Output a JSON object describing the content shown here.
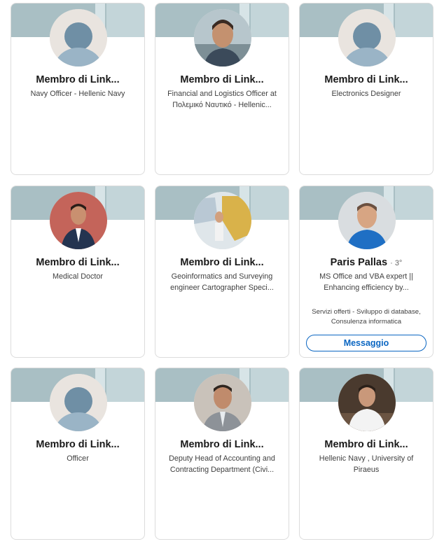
{
  "cards": [
    {
      "name": "Membro di Link...",
      "headline": "Navy Officer - Hellenic Navy",
      "avatar": "default-avatar"
    },
    {
      "name": "Membro di Link...",
      "headline": "Financial and Logistics Officer at Πολεμικό Ναυτικό - Hellenic...",
      "avatar": "profile-photo"
    },
    {
      "name": "Membro di Link...",
      "headline": "Electronics Designer",
      "avatar": "default-avatar"
    },
    {
      "name": "Membro di Link...",
      "headline": "Medical Doctor",
      "avatar": "profile-photo"
    },
    {
      "name": "Membro di Link...",
      "headline": "Geoinformatics and Surveying engineer Cartographer Speci...",
      "avatar": "profile-photo"
    },
    {
      "name": "Paris Pallas",
      "degree": "· 3°",
      "headline": "MS Office and VBA expert || Enhancing efficiency by...",
      "services": "Servizi offerti - Sviluppo di database, Consulenza informatica",
      "button": "Messaggio",
      "avatar": "profile-photo"
    },
    {
      "name": "Membro di Link...",
      "headline": "Officer",
      "avatar": "default-avatar"
    },
    {
      "name": "Membro di Link...",
      "headline": "Deputy Head of Accounting and Contracting Department (Civi...",
      "avatar": "profile-photo"
    },
    {
      "name": "Membro di Link...",
      "headline": "Hellenic Navy , University of Piraeus",
      "avatar": "profile-photo"
    }
  ],
  "colors": {
    "banner": "#a9bfc4",
    "accent": "#0a66c2",
    "default_avatar_bg": "#e9e4df",
    "default_avatar_figure": "#6f8fa5"
  }
}
